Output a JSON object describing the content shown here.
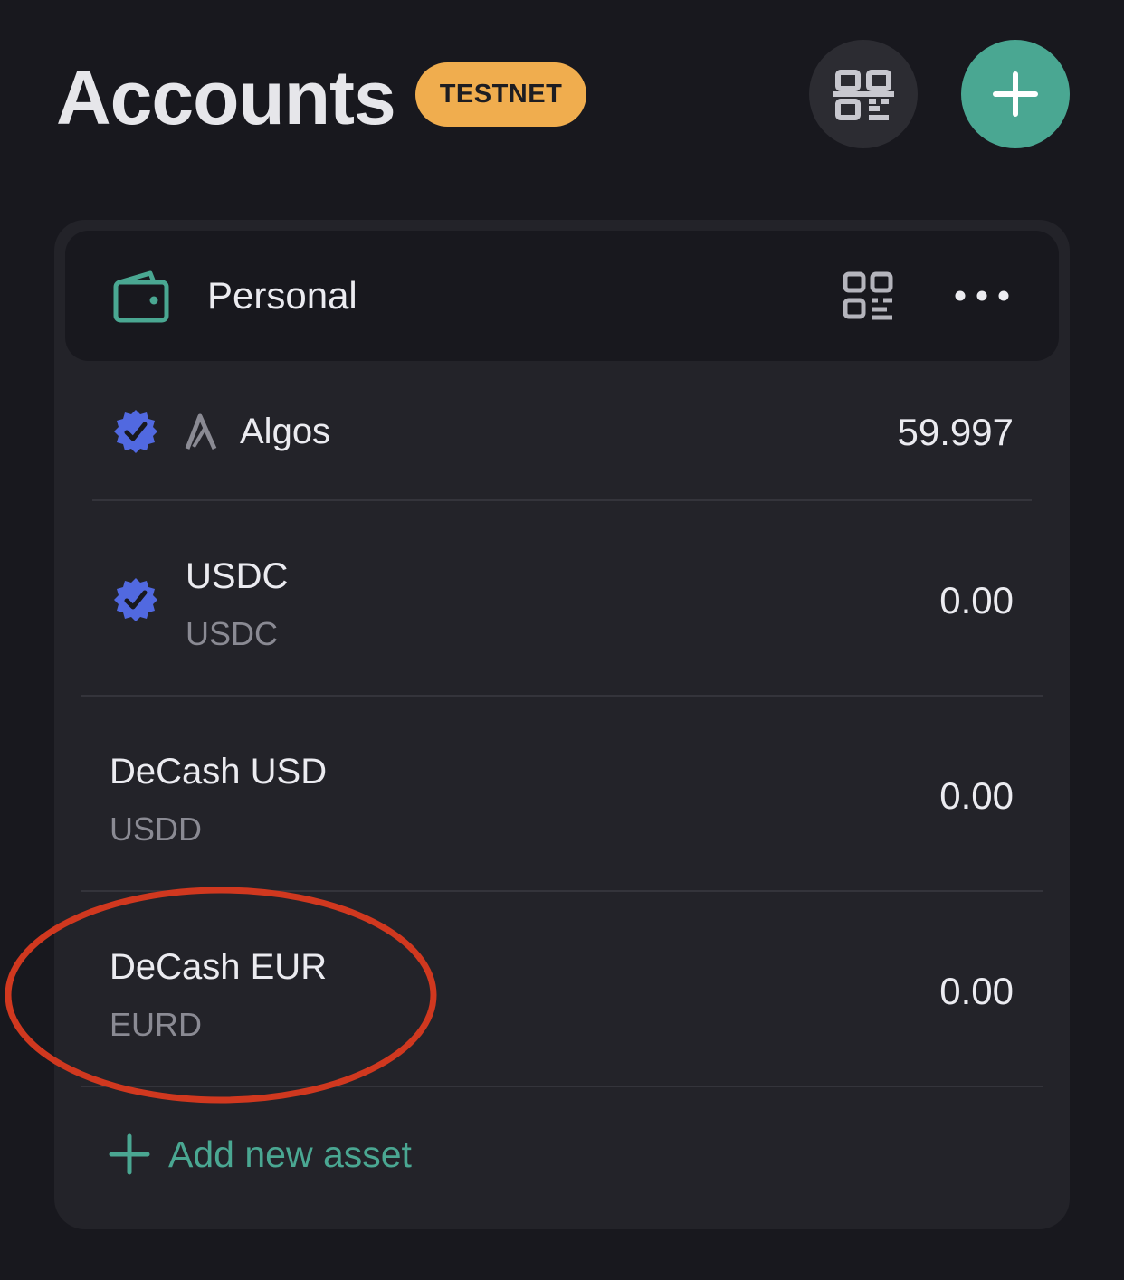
{
  "header": {
    "title": "Accounts",
    "network_badge": "TESTNET"
  },
  "account": {
    "name": "Personal"
  },
  "assets": [
    {
      "name": "Algos",
      "unit": "",
      "amount": "59.997",
      "verified": true
    },
    {
      "name": "USDC",
      "unit": "USDC",
      "amount": "0.00",
      "verified": true
    },
    {
      "name": "DeCash USD",
      "unit": "USDD",
      "amount": "0.00",
      "verified": false
    },
    {
      "name": "DeCash EUR",
      "unit": "EURD",
      "amount": "0.00",
      "verified": false
    }
  ],
  "add_asset_label": "Add new asset",
  "colors": {
    "background": "#18181e",
    "card": "#232329",
    "accent": "#4aa792",
    "badge": "#f0ad4e",
    "verified": "#5169e0",
    "annotation": "#d0381f"
  },
  "icons": {
    "scan": "scan-qr-icon",
    "add": "plus-icon",
    "wallet": "wallet-icon",
    "qr": "qr-code-icon",
    "more": "more-dots-icon",
    "verified": "verified-badge-icon",
    "algo": "algorand-logo-icon"
  }
}
